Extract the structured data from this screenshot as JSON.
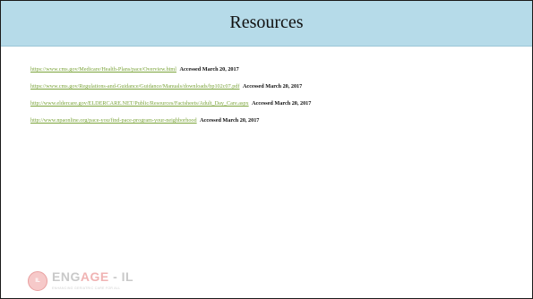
{
  "slide": {
    "title": "Resources"
  },
  "resources": [
    {
      "url": "https://www.cms.gov/Medicare/Health-Plans/pace/Overview.html",
      "accessed": "Accessed March 20, 2017"
    },
    {
      "url": "https://www.cms.gov/Regulations-and-Guidance/Guidance/Manuals/downloads/bp102c07.pdf",
      "accessed": "Accessed March 20, 2017"
    },
    {
      "url": "http://www.eldercare.gov/ELDERCARE.NET/Public/Resources/Factsheets/Adult_Day_Care.aspx",
      "accessed": "Accessed March 20, 2017"
    },
    {
      "url": "http://www.npaonline.org/pace-you/find-pace-program-your-neighborhood",
      "accessed": "Accessed March 20, 2017"
    }
  ],
  "logo": {
    "badge_letters": "IL",
    "word_prefix": "ENG",
    "word_accent": "AGE",
    "word_suffix": " - IL",
    "tagline": "ENHANCING GERIATRIC CARE FOR ALL"
  },
  "colors": {
    "title_band": "#b6dbe9",
    "link": "#7ba43a",
    "border": "#1a1a1a"
  }
}
